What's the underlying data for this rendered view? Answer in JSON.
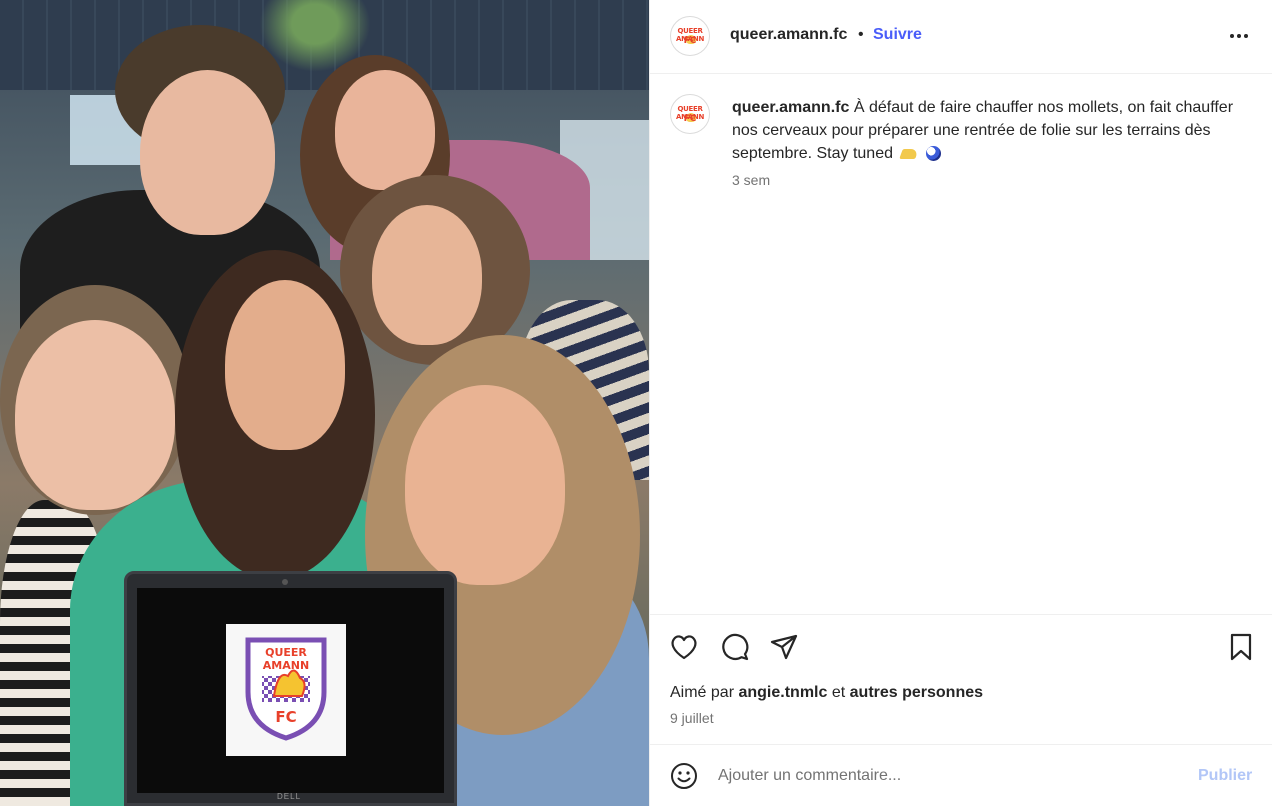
{
  "post": {
    "username": "queer.amann.fc",
    "separator": "•",
    "follow_label": "Suivre",
    "more_icon": "more-horizontal-icon",
    "avatar_logo_top": "QUEER AMANN",
    "avatar_logo_bottom": "FC"
  },
  "photo": {
    "logo_top_text": "QUEER AMANN",
    "logo_bottom_text": "FC",
    "laptop_brand": "DELL"
  },
  "caption": {
    "username": "queer.amann.fc",
    "text": "À défaut de faire chauffer nos mollets, on fait chauffer nos cerveaux pour préparer une rentrée de folie sur les terrains dès septembre. Stay tuned",
    "emojis": [
      "cheese-emoji",
      "soccer-ball-emoji"
    ],
    "time": "3 sem"
  },
  "actions": {
    "icons": [
      "heart-icon",
      "comment-icon",
      "share-icon",
      "bookmark-icon"
    ],
    "liked_by_prefix": "Aimé par",
    "liked_by_user": "angie.tnmlc",
    "liked_by_joiner": "et",
    "liked_by_others": "autres personnes",
    "date": "9 juillet"
  },
  "comment": {
    "placeholder": "Ajouter un commentaire...",
    "publish_label": "Publier",
    "emoji_icon": "smiley-icon"
  },
  "colors": {
    "accent_blue": "#4a5df9",
    "publish_disabled": "#b2c6f7",
    "text_primary": "#262626",
    "text_secondary": "#737373",
    "logo_red": "#e8402a"
  }
}
